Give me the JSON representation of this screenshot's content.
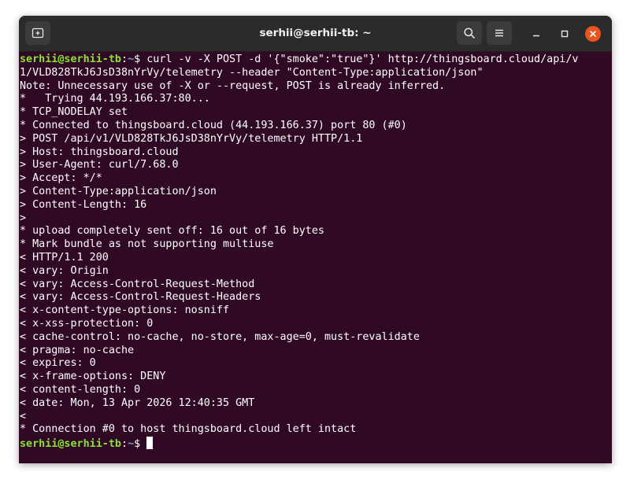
{
  "window": {
    "title": "serhii@serhii-tb: ~"
  },
  "icons": {
    "new_tab": "new-tab-icon",
    "search": "search-icon",
    "menu": "hamburger-menu-icon",
    "minimize": "minimize-icon",
    "maximize": "maximize-icon",
    "close": "close-icon"
  },
  "colors": {
    "terminal_bg": "#300a24",
    "prompt_user": "#8ae234",
    "prompt_path": "#729fcf",
    "close_button": "#e95420"
  },
  "terminal": {
    "prompt": {
      "user_host": "serhii@serhii-tb",
      "path": "~",
      "symbol": "$ "
    },
    "command_part1": "curl -v -X POST -d '{\"smoke\":\"true\"}' http://thingsboard.cloud/api/v",
    "command_part2": "1/VLD828TkJ6JsD38nYrVy/telemetry --header \"Content-Type:application/json\"",
    "output": [
      "Note: Unnecessary use of -X or --request, POST is already inferred.",
      "*   Trying 44.193.166.37:80...",
      "* TCP_NODELAY set",
      "* Connected to thingsboard.cloud (44.193.166.37) port 80 (#0)",
      "> POST /api/v1/VLD828TkJ6JsD38nYrVy/telemetry HTTP/1.1",
      "> Host: thingsboard.cloud",
      "> User-Agent: curl/7.68.0",
      "> Accept: */*",
      "> Content-Type:application/json",
      "> Content-Length: 16",
      ">",
      "* upload completely sent off: 16 out of 16 bytes",
      "* Mark bundle as not supporting multiuse",
      "< HTTP/1.1 200",
      "< vary: Origin",
      "< vary: Access-Control-Request-Method",
      "< vary: Access-Control-Request-Headers",
      "< x-content-type-options: nosniff",
      "< x-xss-protection: 0",
      "< cache-control: no-cache, no-store, max-age=0, must-revalidate",
      "< pragma: no-cache",
      "< expires: 0",
      "< x-frame-options: DENY",
      "< content-length: 0",
      "< date: Mon, 13 Apr 2026 12:40:35 GMT",
      "<",
      "* Connection #0 to host thingsboard.cloud left intact"
    ]
  }
}
